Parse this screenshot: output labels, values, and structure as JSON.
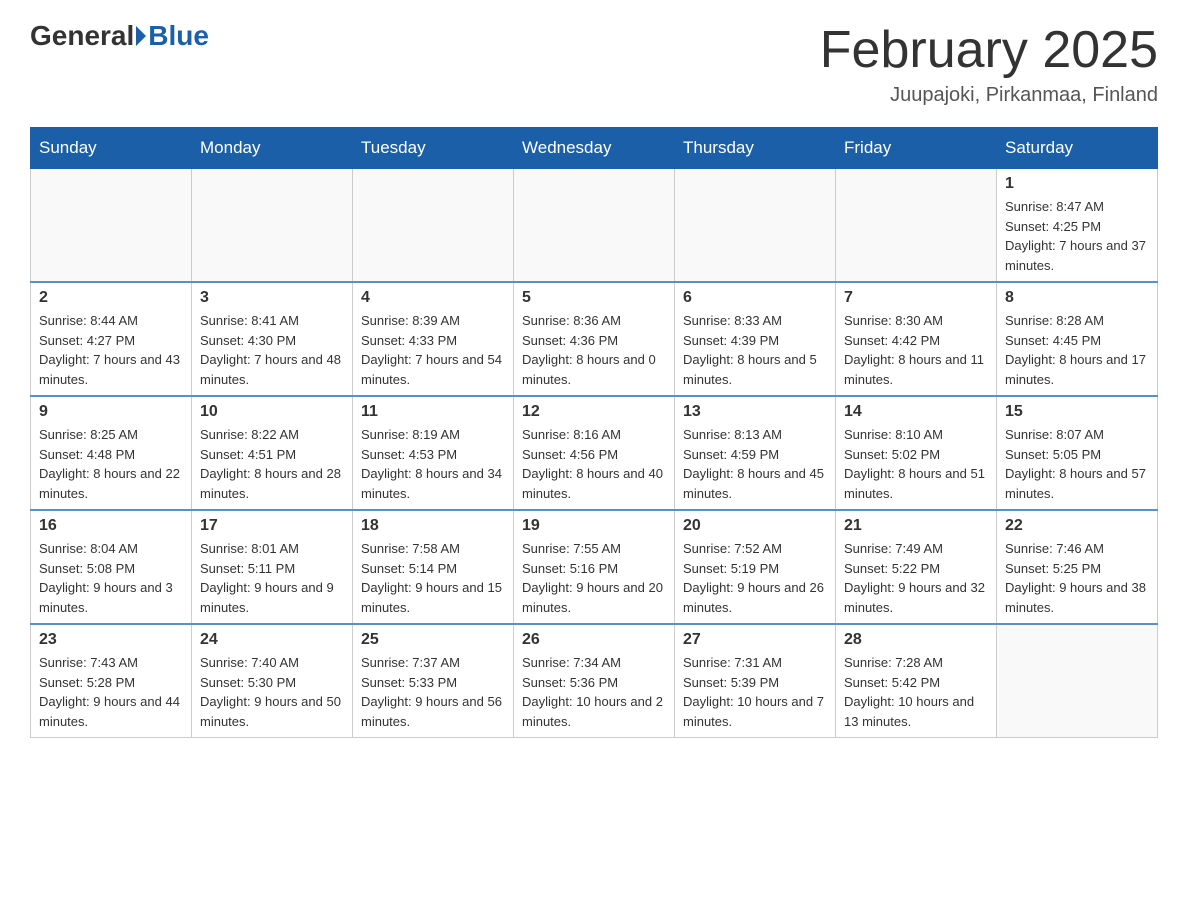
{
  "header": {
    "logo_general": "General",
    "logo_blue": "Blue",
    "title": "February 2025",
    "subtitle": "Juupajoki, Pirkanmaa, Finland"
  },
  "weekdays": [
    "Sunday",
    "Monday",
    "Tuesday",
    "Wednesday",
    "Thursday",
    "Friday",
    "Saturday"
  ],
  "weeks": [
    [
      {
        "day": "",
        "info": ""
      },
      {
        "day": "",
        "info": ""
      },
      {
        "day": "",
        "info": ""
      },
      {
        "day": "",
        "info": ""
      },
      {
        "day": "",
        "info": ""
      },
      {
        "day": "",
        "info": ""
      },
      {
        "day": "1",
        "info": "Sunrise: 8:47 AM\nSunset: 4:25 PM\nDaylight: 7 hours and 37 minutes."
      }
    ],
    [
      {
        "day": "2",
        "info": "Sunrise: 8:44 AM\nSunset: 4:27 PM\nDaylight: 7 hours and 43 minutes."
      },
      {
        "day": "3",
        "info": "Sunrise: 8:41 AM\nSunset: 4:30 PM\nDaylight: 7 hours and 48 minutes."
      },
      {
        "day": "4",
        "info": "Sunrise: 8:39 AM\nSunset: 4:33 PM\nDaylight: 7 hours and 54 minutes."
      },
      {
        "day": "5",
        "info": "Sunrise: 8:36 AM\nSunset: 4:36 PM\nDaylight: 8 hours and 0 minutes."
      },
      {
        "day": "6",
        "info": "Sunrise: 8:33 AM\nSunset: 4:39 PM\nDaylight: 8 hours and 5 minutes."
      },
      {
        "day": "7",
        "info": "Sunrise: 8:30 AM\nSunset: 4:42 PM\nDaylight: 8 hours and 11 minutes."
      },
      {
        "day": "8",
        "info": "Sunrise: 8:28 AM\nSunset: 4:45 PM\nDaylight: 8 hours and 17 minutes."
      }
    ],
    [
      {
        "day": "9",
        "info": "Sunrise: 8:25 AM\nSunset: 4:48 PM\nDaylight: 8 hours and 22 minutes."
      },
      {
        "day": "10",
        "info": "Sunrise: 8:22 AM\nSunset: 4:51 PM\nDaylight: 8 hours and 28 minutes."
      },
      {
        "day": "11",
        "info": "Sunrise: 8:19 AM\nSunset: 4:53 PM\nDaylight: 8 hours and 34 minutes."
      },
      {
        "day": "12",
        "info": "Sunrise: 8:16 AM\nSunset: 4:56 PM\nDaylight: 8 hours and 40 minutes."
      },
      {
        "day": "13",
        "info": "Sunrise: 8:13 AM\nSunset: 4:59 PM\nDaylight: 8 hours and 45 minutes."
      },
      {
        "day": "14",
        "info": "Sunrise: 8:10 AM\nSunset: 5:02 PM\nDaylight: 8 hours and 51 minutes."
      },
      {
        "day": "15",
        "info": "Sunrise: 8:07 AM\nSunset: 5:05 PM\nDaylight: 8 hours and 57 minutes."
      }
    ],
    [
      {
        "day": "16",
        "info": "Sunrise: 8:04 AM\nSunset: 5:08 PM\nDaylight: 9 hours and 3 minutes."
      },
      {
        "day": "17",
        "info": "Sunrise: 8:01 AM\nSunset: 5:11 PM\nDaylight: 9 hours and 9 minutes."
      },
      {
        "day": "18",
        "info": "Sunrise: 7:58 AM\nSunset: 5:14 PM\nDaylight: 9 hours and 15 minutes."
      },
      {
        "day": "19",
        "info": "Sunrise: 7:55 AM\nSunset: 5:16 PM\nDaylight: 9 hours and 20 minutes."
      },
      {
        "day": "20",
        "info": "Sunrise: 7:52 AM\nSunset: 5:19 PM\nDaylight: 9 hours and 26 minutes."
      },
      {
        "day": "21",
        "info": "Sunrise: 7:49 AM\nSunset: 5:22 PM\nDaylight: 9 hours and 32 minutes."
      },
      {
        "day": "22",
        "info": "Sunrise: 7:46 AM\nSunset: 5:25 PM\nDaylight: 9 hours and 38 minutes."
      }
    ],
    [
      {
        "day": "23",
        "info": "Sunrise: 7:43 AM\nSunset: 5:28 PM\nDaylight: 9 hours and 44 minutes."
      },
      {
        "day": "24",
        "info": "Sunrise: 7:40 AM\nSunset: 5:30 PM\nDaylight: 9 hours and 50 minutes."
      },
      {
        "day": "25",
        "info": "Sunrise: 7:37 AM\nSunset: 5:33 PM\nDaylight: 9 hours and 56 minutes."
      },
      {
        "day": "26",
        "info": "Sunrise: 7:34 AM\nSunset: 5:36 PM\nDaylight: 10 hours and 2 minutes."
      },
      {
        "day": "27",
        "info": "Sunrise: 7:31 AM\nSunset: 5:39 PM\nDaylight: 10 hours and 7 minutes."
      },
      {
        "day": "28",
        "info": "Sunrise: 7:28 AM\nSunset: 5:42 PM\nDaylight: 10 hours and 13 minutes."
      },
      {
        "day": "",
        "info": ""
      }
    ]
  ]
}
